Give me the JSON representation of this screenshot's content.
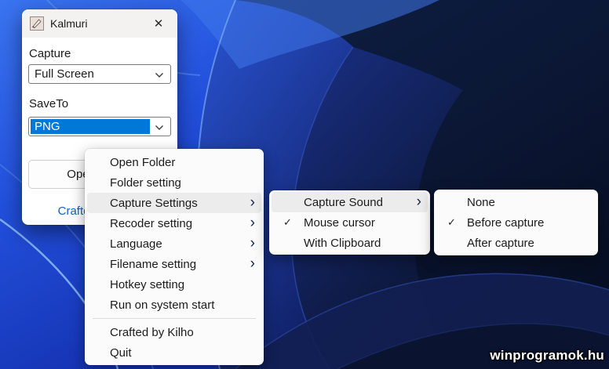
{
  "window": {
    "title": "Kalmuri",
    "capture_label": "Capture",
    "capture_value": "Full Screen",
    "saveto_label": "SaveTo",
    "saveto_value": "PNG",
    "open_button_label": "Open Folder",
    "link_label": "Crafted by Kilho"
  },
  "menu": {
    "items": [
      {
        "label": "Open Folder"
      },
      {
        "label": "Folder setting"
      },
      {
        "label": "Capture Settings",
        "has_submenu": true,
        "highlighted": true
      },
      {
        "label": "Recoder setting",
        "has_submenu": true
      },
      {
        "label": "Language",
        "has_submenu": true
      },
      {
        "label": "Filename setting",
        "has_submenu": true
      },
      {
        "label": "Hotkey setting"
      },
      {
        "label": "Run on system start"
      },
      {
        "label": "Crafted by Kilho"
      },
      {
        "label": "Quit"
      }
    ]
  },
  "submenu_capture": {
    "items": [
      {
        "label": "Capture Sound",
        "has_submenu": true,
        "highlighted": true
      },
      {
        "label": "Mouse cursor",
        "checked": true
      },
      {
        "label": "With Clipboard"
      }
    ]
  },
  "submenu_sound": {
    "items": [
      {
        "label": "None"
      },
      {
        "label": "Before capture",
        "checked": true
      },
      {
        "label": "After capture"
      }
    ]
  },
  "watermark": {
    "text": "winprogramok.hu"
  },
  "glyphs": {
    "close": "✕",
    "check": "✓",
    "chevron_right": "›"
  },
  "colors": {
    "selection_blue": "#0078d7",
    "link_blue": "#0a63cc",
    "menu_highlight": "#ececec",
    "menu_bg": "#fbfbfb",
    "titlebar_bg": "#f3f2f0"
  }
}
